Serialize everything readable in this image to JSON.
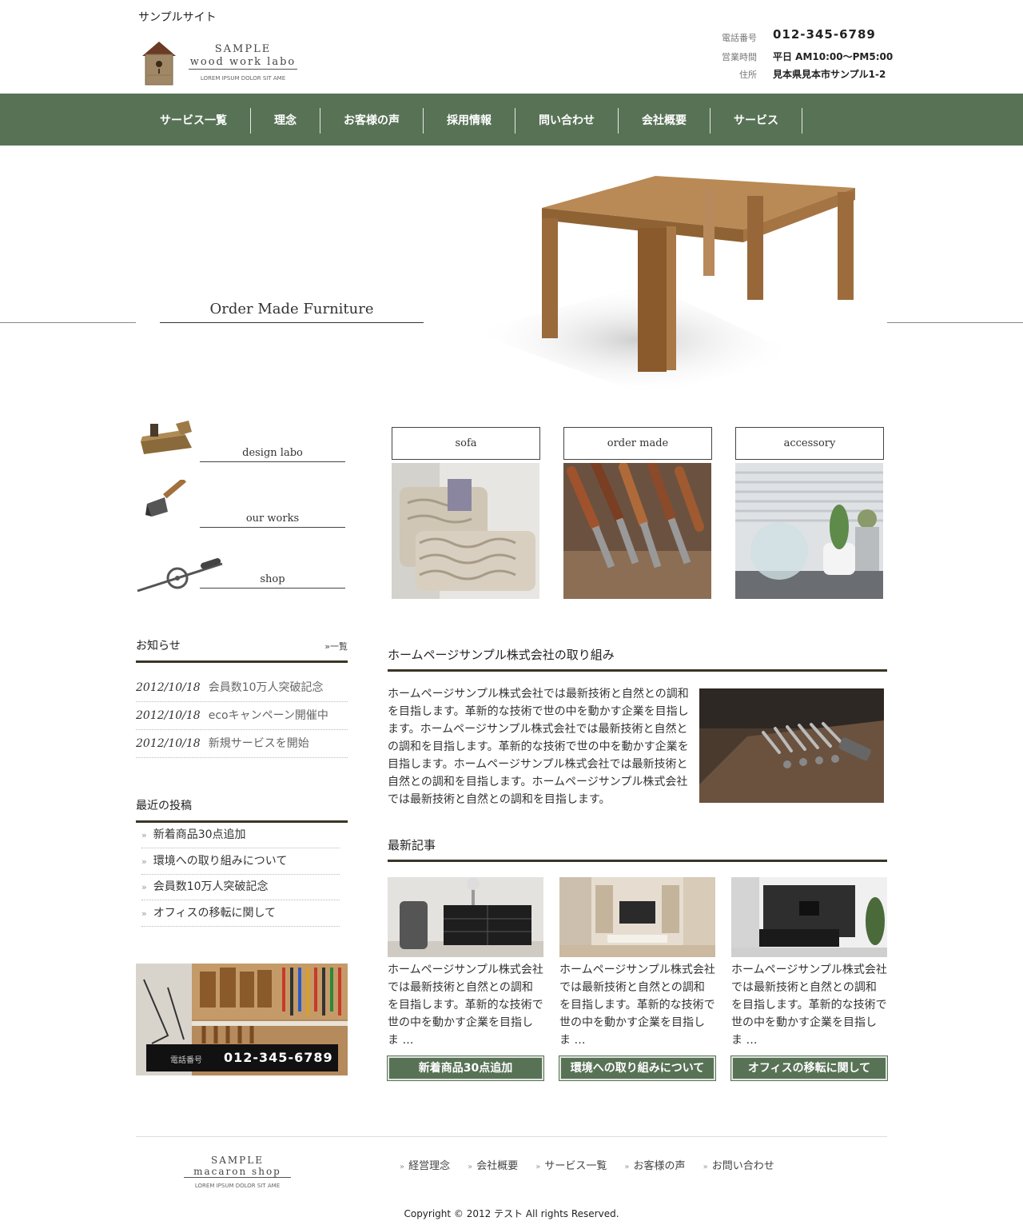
{
  "site": {
    "name": "サンプルサイト"
  },
  "logo": {
    "line1": "SAMPLE",
    "line2": "wood work labo",
    "line3": "LOREM IPSUM DOLOR SIT AME"
  },
  "contact": {
    "phone_label": "電話番号",
    "phone": "012-345-6789",
    "hours_label": "営業時間",
    "hours": "平日 AM10:00～PM5:00",
    "address_label": "住所",
    "address": "見本県見本市サンプル1-2"
  },
  "nav": {
    "items": [
      "サービス一覧",
      "理念",
      "お客様の声",
      "採用情報",
      "問い合わせ",
      "会社概要",
      "サービス"
    ]
  },
  "hero": {
    "title": "Order Made Furniture"
  },
  "side_links": [
    "design labo",
    "our works",
    "shop"
  ],
  "categories": [
    "sofa",
    "order made",
    "accessory"
  ],
  "news": {
    "heading": "お知らせ",
    "more": "»一覧",
    "items": [
      {
        "date": "2012/10/18",
        "title": "会員数10万人突破記念"
      },
      {
        "date": "2012/10/18",
        "title": "ecoキャンペーン開催中"
      },
      {
        "date": "2012/10/18",
        "title": "新規サービスを開始"
      }
    ]
  },
  "recent_posts": {
    "heading": "最近の投稿",
    "items": [
      "新着商品30点追加",
      "環境への取り組みについて",
      "会員数10万人突破記念",
      "オフィスの移転に関して"
    ]
  },
  "banner": {
    "phone_label": "電話番号",
    "phone": "012-345-6789"
  },
  "about": {
    "heading": "ホームページサンプル株式会社の取り組み",
    "text": "ホームページサンプル株式会社では最新技術と自然との調和を目指します。革新的な技術で世の中を動かす企業を目指します。ホームページサンプル株式会社では最新技術と自然との調和を目指します。革新的な技術で世の中を動かす企業を目指します。ホームページサンプル株式会社では最新技術と自然との調和を目指します。ホームページサンプル株式会社では最新技術と自然との調和を目指します。"
  },
  "articles": {
    "heading": "最新記事",
    "items": [
      {
        "text": "ホームページサンプル株式会社では最新技術と自然との調和を目指します。革新的な技術で世の中を動かす企業を目指しま …",
        "button": "新着商品30点追加"
      },
      {
        "text": "ホームページサンプル株式会社では最新技術と自然との調和を目指します。革新的な技術で世の中を動かす企業を目指しま …",
        "button": "環境への取り組みについて"
      },
      {
        "text": "ホームページサンプル株式会社では最新技術と自然との調和を目指します。革新的な技術で世の中を動かす企業を目指しま …",
        "button": "オフィスの移転に関して"
      }
    ]
  },
  "footer": {
    "logo": {
      "line1": "SAMPLE",
      "line2": "macaron shop",
      "line3": "LOREM IPSUM DOLOR SIT AME"
    },
    "mark": "»",
    "links": [
      "経営理念",
      "会社概要",
      "サービス一覧",
      "お客様の声",
      "お問い合わせ"
    ],
    "copyright": "Copyright © 2012 テスト All rights Reserved."
  },
  "colors": {
    "nav_green": "#587256",
    "rule_dark": "#3a3526"
  }
}
